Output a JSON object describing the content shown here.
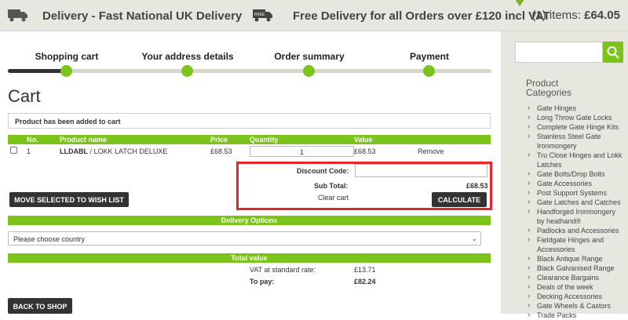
{
  "topbar": {
    "delivery_text": "Delivery - Fast National UK Delivery",
    "free_delivery_text": "Free Delivery for all Orders over £120 incl VAT",
    "items_count": "(1) items:",
    "items_total": "£64.05",
    "free_icon_label": "FREE"
  },
  "steps": [
    {
      "label": "Shopping cart"
    },
    {
      "label": "Your address details"
    },
    {
      "label": "Order summary"
    },
    {
      "label": "Payment"
    }
  ],
  "cart": {
    "title": "Cart",
    "notice": "Product has been added to cart",
    "headers": {
      "no": "No.",
      "product": "Product name",
      "price": "Price",
      "quantity": "Quantity",
      "value": "Value"
    },
    "items": [
      {
        "no": "1",
        "code": "LLDABL",
        "sep": " / ",
        "name": "LOKK LATCH DELUXE",
        "price": "£68.53",
        "quantity": "1",
        "value": "£68.53",
        "remove": "Remove"
      }
    ],
    "discount_label": "Discount Code:",
    "discount_value": "",
    "subtotal_label": "Sub Total:",
    "subtotal_value": "£68.53",
    "clear_cart": "Clear cart",
    "calculate": "CALCULATE",
    "wishlist": "MOVE SELECTED TO WISH LIST"
  },
  "delivery": {
    "header": "Delivery Options",
    "country_placeholder": "Please choose country"
  },
  "totals": {
    "header": "Total value",
    "vat_label": "VAT at standard rate:",
    "vat_value": "£13.71",
    "pay_label": "To pay:",
    "pay_value": "£82.24"
  },
  "back_to_shop": "BACK TO SHOP",
  "sidebar": {
    "search_placeholder": "",
    "title_line1": "Product",
    "title_line2": "Categories",
    "categories": [
      "Gate Hinges",
      "Long Throw Gate Locks",
      "Complete Gate Hinge Kits",
      "Stainless Steel Gate Ironmongery",
      "Tru Close Hinges and Lokk Latches",
      "Gate Bolts/Drop Bolts",
      "Gate Accessories",
      "Post Support Systems",
      "Gate Latches and Catches",
      "Handforged Ironmongery by heathand®",
      "Padlocks and Accessories",
      "Fieldgate Hinges and Accessories",
      "Black Antique Range",
      "Black Galvanised Range",
      "Clearance Bargains",
      "Deals of the week",
      "Decking Accessories",
      "Gate Wheels & Castors",
      "Trade Packs"
    ]
  },
  "colors": {
    "accent": "#7cc41c",
    "highlight": "#e5252b",
    "dark": "#333333",
    "bar_bg": "#e7e7e0"
  }
}
